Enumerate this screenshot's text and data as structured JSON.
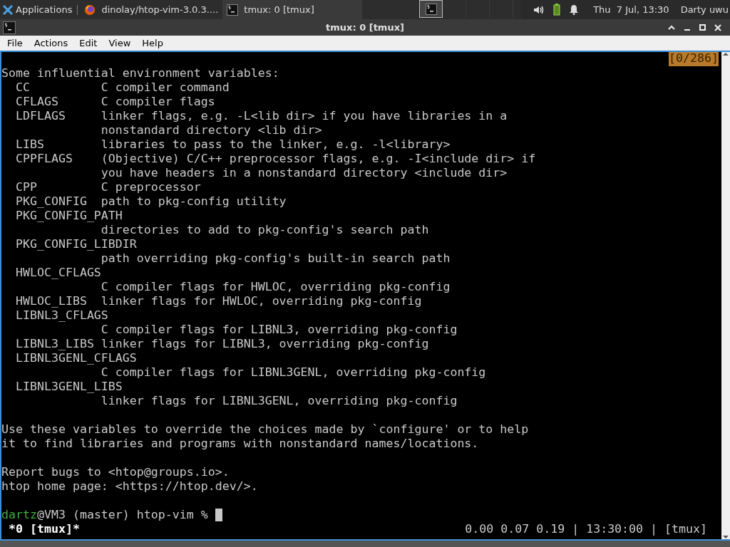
{
  "panel": {
    "apps_label": "Applications",
    "tasks": [
      {
        "label": "dinolay/htop-vim-3.0.3....",
        "selected": false
      },
      {
        "label": "tmux: 0 [tmux]",
        "selected": true
      }
    ],
    "workspaces": [
      {
        "selected": true,
        "has_window": true
      },
      {
        "selected": false,
        "has_window": false
      },
      {
        "selected": false,
        "has_window": false
      },
      {
        "selected": false,
        "has_window": false
      }
    ],
    "clock": "Thu  7 Jul, 13:30",
    "user": "Darty uwu"
  },
  "window": {
    "title": "tmux: 0 [tmux]"
  },
  "menu": [
    "File",
    "Actions",
    "Edit",
    "View",
    "Help"
  ],
  "terminal": {
    "position_indicator": "[0/286]",
    "blocks": [
      [
        "Some influential environment variables:",
        "  CC          C compiler command",
        "  CFLAGS      C compiler flags",
        "  LDFLAGS     linker flags, e.g. -L<lib dir> if you have libraries in a",
        "              nonstandard directory <lib dir>",
        "  LIBS        libraries to pass to the linker, e.g. -l<library>",
        "  CPPFLAGS    (Objective) C/C++ preprocessor flags, e.g. -I<include dir> if",
        "              you have headers in a nonstandard directory <include dir>",
        "  CPP         C preprocessor",
        "  PKG_CONFIG  path to pkg-config utility",
        "  PKG_CONFIG_PATH",
        "              directories to add to pkg-config's search path",
        "  PKG_CONFIG_LIBDIR",
        "              path overriding pkg-config's built-in search path",
        "  HWLOC_CFLAGS",
        "              C compiler flags for HWLOC, overriding pkg-config",
        "  HWLOC_LIBS  linker flags for HWLOC, overriding pkg-config",
        "  LIBNL3_CFLAGS",
        "              C compiler flags for LIBNL3, overriding pkg-config",
        "  LIBNL3_LIBS linker flags for LIBNL3, overriding pkg-config",
        "  LIBNL3GENL_CFLAGS",
        "              C compiler flags for LIBNL3GENL, overriding pkg-config",
        "  LIBNL3GENL_LIBS",
        "              linker flags for LIBNL3GENL, overriding pkg-config"
      ],
      [
        "Use these variables to override the choices made by `configure' or to help",
        "it to find libraries and programs with nonstandard names/locations."
      ],
      [
        "Report bugs to <htop@groups.io>.",
        "htop home page: <https://htop.dev/>."
      ]
    ],
    "prompt": {
      "user": "dartz",
      "rest": "@VM3 (master) htop-vim %"
    },
    "status_left": " *0 [tmux]*",
    "status_right": "0.00 0.07 0.19 | 13:30:00 | [tmux]"
  }
}
